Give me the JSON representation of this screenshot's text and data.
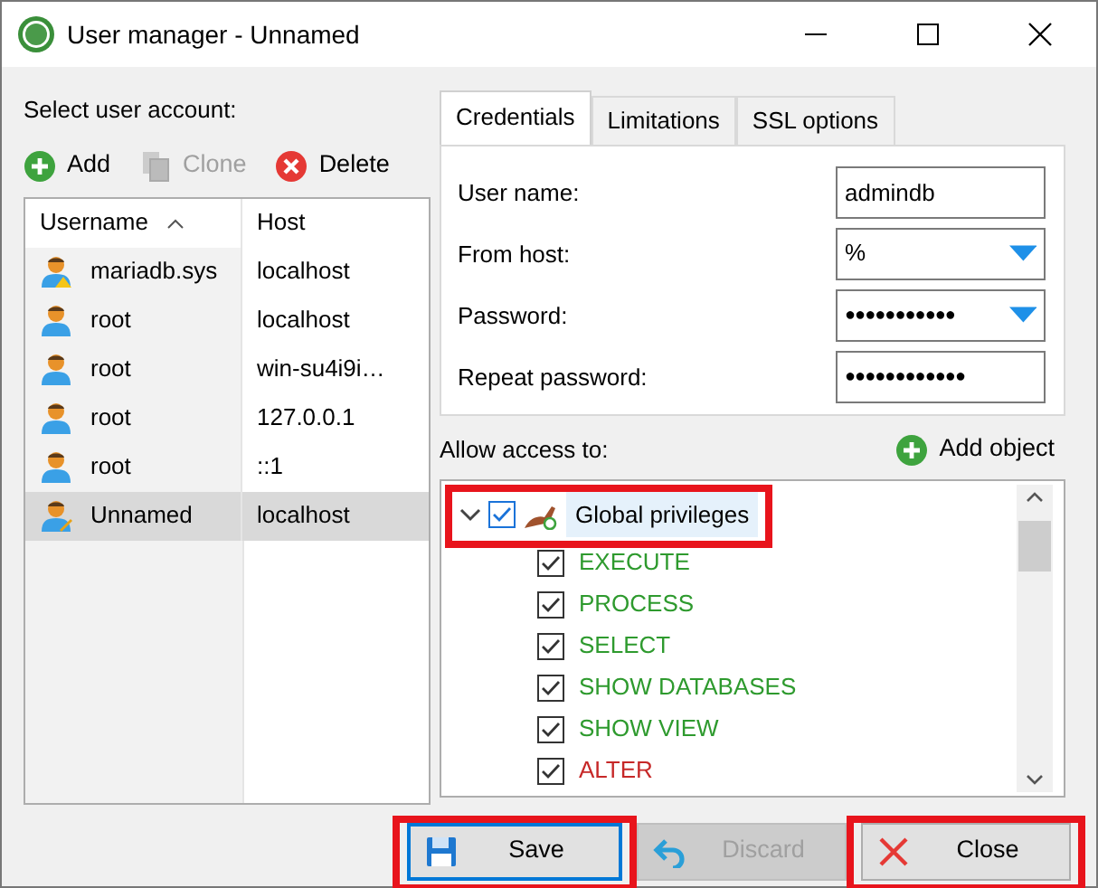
{
  "window": {
    "title": "User manager - Unnamed"
  },
  "accounts": {
    "label": "Select user account:",
    "toolbar": [
      {
        "label": "Add",
        "kind": "add",
        "disabled": false
      },
      {
        "label": "Clone",
        "kind": "clone",
        "disabled": true
      },
      {
        "label": "Delete",
        "kind": "delete",
        "disabled": false
      }
    ],
    "columns": [
      {
        "label": "Username",
        "sorted": true
      },
      {
        "label": "Host",
        "sorted": false
      }
    ],
    "rows": [
      {
        "username": "mariadb.sys",
        "host": "localhost",
        "kind": "warning",
        "selected": false
      },
      {
        "username": "root",
        "host": "localhost",
        "kind": "normal",
        "selected": false
      },
      {
        "username": "root",
        "host": "win-su4i9i…",
        "kind": "normal",
        "selected": false
      },
      {
        "username": "root",
        "host": "127.0.0.1",
        "kind": "normal",
        "selected": false
      },
      {
        "username": "root",
        "host": "::1",
        "kind": "normal",
        "selected": false
      },
      {
        "username": "Unnamed",
        "host": "localhost",
        "kind": "edited",
        "selected": true
      }
    ]
  },
  "tabs": [
    {
      "label": "Credentials",
      "selected": true
    },
    {
      "label": "Limitations",
      "selected": false
    },
    {
      "label": "SSL options",
      "selected": false
    }
  ],
  "credentials": [
    {
      "label": "User name:",
      "kind": "text",
      "value": "admindb"
    },
    {
      "label": "From host:",
      "kind": "combo",
      "value": "%"
    },
    {
      "label": "Password:",
      "kind": "combo",
      "value": "●●●●●●●●●●●"
    },
    {
      "label": "Repeat password:",
      "kind": "text",
      "value": "●●●●●●●●●●●●"
    }
  ],
  "access": {
    "label": "Allow access to:",
    "add_label": "Add object",
    "tree": [
      {
        "label": "Global privileges",
        "checked": true,
        "expanded": true,
        "highlighted": true,
        "children": [
          {
            "label": "EXECUTE",
            "checked": true,
            "color": "#2e9a2e"
          },
          {
            "label": "PROCESS",
            "checked": true,
            "color": "#2e9a2e"
          },
          {
            "label": "SELECT",
            "checked": true,
            "color": "#2e9a2e"
          },
          {
            "label": "SHOW DATABASES",
            "checked": true,
            "color": "#2e9a2e"
          },
          {
            "label": "SHOW VIEW",
            "checked": true,
            "color": "#2e9a2e"
          },
          {
            "label": "ALTER",
            "checked": true,
            "color": "#c62828"
          }
        ]
      }
    ]
  },
  "buttons": [
    {
      "label": "Save",
      "kind": "save",
      "disabled": false,
      "focused": true,
      "highlighted": true
    },
    {
      "label": "Discard",
      "kind": "discard",
      "disabled": true,
      "focused": false,
      "highlighted": false
    },
    {
      "label": "Close",
      "kind": "close",
      "disabled": false,
      "focused": false,
      "highlighted": true
    }
  ]
}
